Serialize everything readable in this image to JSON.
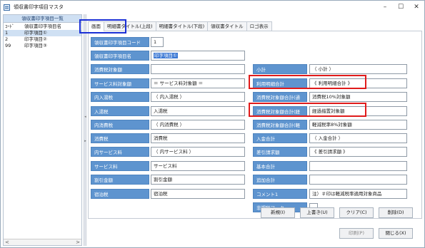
{
  "window": {
    "title": "領収書印字項目マスタ",
    "minimize": "–",
    "maximize": "☐",
    "close": "✕"
  },
  "list": {
    "header": "領収書印字項目一覧",
    "col_code": "ｺｰﾄﾞ",
    "col_name": "領収書印字項目名",
    "rows": [
      {
        "code": "1",
        "name": "印字項目①"
      },
      {
        "code": "2",
        "name": "印字項目②"
      },
      {
        "code": "99",
        "name": "印字項目③"
      }
    ],
    "scroll_left": "<",
    "scroll_right": ">"
  },
  "tabs": [
    "画面",
    "明細書タイトル(上段)",
    "明細書タイトル(下段)",
    "領収書タイトル",
    "ロゴ表示"
  ],
  "fields": {
    "code": {
      "label": "領収書印字項目コード",
      "value": "1"
    },
    "name": {
      "label": "領収書印字項目名",
      "value": "印字項目①"
    },
    "shohizei_taisho": {
      "label": "消費税対象額",
      "value": ""
    },
    "service_taisho": {
      "label": "サービス料対象額",
      "value": "＝ サービス料対象額 ＝"
    },
    "uchiiri_zei": {
      "label": "内入湯税",
      "value": "（ 内入湯税 ）"
    },
    "nyuto_zei": {
      "label": "入湯税",
      "value": "入湯税"
    },
    "uchi_shohizei": {
      "label": "内消費税",
      "value": "（ 内消費税 ）"
    },
    "shohizei": {
      "label": "消費税",
      "value": "消費税"
    },
    "uchi_service": {
      "label": "内サービス料",
      "value": "（ 内サービス料 ）"
    },
    "service": {
      "label": "サービス料",
      "value": "サービス料"
    },
    "waribiki": {
      "label": "割引金額",
      "value": "割引金額"
    },
    "shukuhaku_zei": {
      "label": "宿泊税",
      "value": "宿泊税"
    },
    "shokei": {
      "label": "小計",
      "value": "（ 小計 ）"
    },
    "riyo_meisai": {
      "label": "利用明細合計",
      "value": "《 利用明細合計 》"
    },
    "taisho_tsujo": {
      "label": "消費税対象額合計(通常)",
      "value": "消費税10%対象額"
    },
    "taisho_keika": {
      "label": "消費税対象額合計(経過)",
      "value": "経過措置対象額"
    },
    "taisho_keigen": {
      "label": "消費税対象額合計(軽減)",
      "value": "軽減税率8%対象額"
    },
    "nyukin": {
      "label": "入金合計",
      "value": "（ 入金合計 ）"
    },
    "sashihiki": {
      "label": "差引請求額",
      "value": "《 差引請求額 》"
    },
    "kihon": {
      "label": "基本合計",
      "value": ""
    },
    "tsuika": {
      "label": "追加合計",
      "value": ""
    },
    "comment": {
      "label": "コメント1",
      "value": "注）＃印は軽減税率適用対象商品"
    },
    "hikazei": {
      "label": "非課税マーク",
      "value": ""
    }
  },
  "buttons": {
    "new": "新規(I)",
    "overwrite": "上書き(U)",
    "clear": "クリア(C)",
    "delete": "削除(D)",
    "print": "印刷(P)",
    "close": "閉じる(X)"
  }
}
